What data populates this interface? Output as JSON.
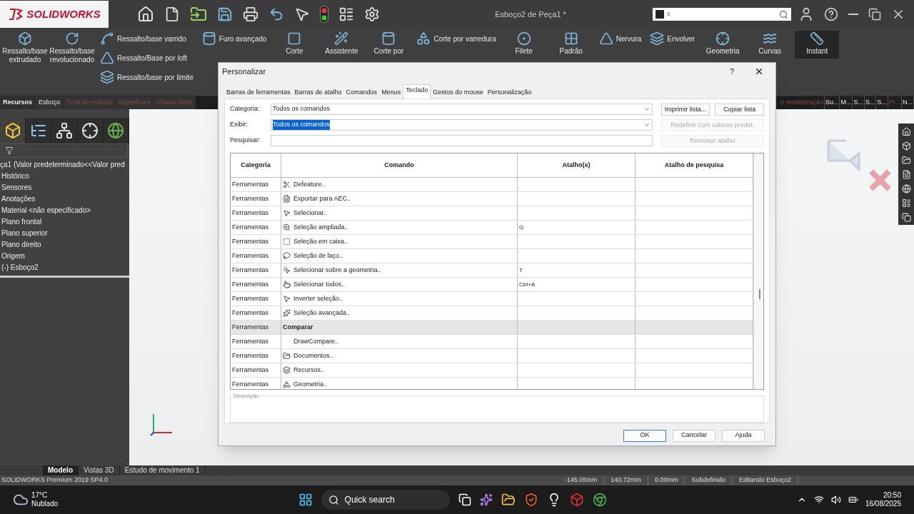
{
  "app": {
    "logo": "SOLIDWORKS",
    "document_title": "Esboço2 de Peça1 *",
    "search": {
      "value": "s"
    }
  },
  "ribbon": [
    {
      "kind": "large",
      "label": "Ressalto/base extrudado"
    },
    {
      "kind": "large",
      "label": "Ressalto/base revolucionado"
    },
    {
      "kind": "stack",
      "items": [
        "Ressalto/base varrido",
        "Ressalto/Base por loft",
        "Ressalto/base por limite"
      ]
    },
    {
      "kind": "stack",
      "items": [
        "Furo avançado"
      ]
    },
    {
      "kind": "large",
      "label": "Corte"
    },
    {
      "kind": "large",
      "label": "Assistente"
    },
    {
      "kind": "large",
      "label": "Corte por"
    },
    {
      "kind": "stack",
      "items": [
        "Corte por varredura"
      ]
    },
    {
      "kind": "large",
      "label": "Filete"
    },
    {
      "kind": "large",
      "label": "Padrão"
    },
    {
      "kind": "stack",
      "items": [
        "Nervura"
      ]
    },
    {
      "kind": "stack",
      "items": [
        "Envolver"
      ]
    },
    {
      "kind": "large",
      "label": "Geometria"
    },
    {
      "kind": "large",
      "label": "Curvas"
    },
    {
      "kind": "large",
      "label": "Instant"
    }
  ],
  "command_tabs": [
    {
      "label": "Recursos",
      "selected": true,
      "disabled": false
    },
    {
      "label": "Esboço",
      "selected": false,
      "disabled": false
    },
    {
      "label": "Tinta de esboço",
      "selected": false,
      "disabled": true
    },
    {
      "label": "Superfícies",
      "selected": false,
      "disabled": true
    },
    {
      "label": "Chapa meta",
      "selected": false,
      "disabled": true
    }
  ],
  "command_tabs_right": [
    {
      "label": "e renderização",
      "selected": false,
      "disabled": true
    },
    {
      "label": "Su...",
      "selected": false,
      "disabled": false
    },
    {
      "label": "M...",
      "selected": false,
      "disabled": false
    },
    {
      "label": "S...",
      "selected": false,
      "disabled": false
    },
    {
      "label": "S...",
      "selected": false,
      "disabled": false
    },
    {
      "label": "S...",
      "selected": false,
      "disabled": false
    },
    {
      "label": "Pr...",
      "selected": false,
      "disabled": true
    },
    {
      "label": "N...",
      "selected": false,
      "disabled": false
    }
  ],
  "feature_tree": {
    "panel_tabs": [
      {
        "selected": true
      },
      {
        "selected": false
      },
      {
        "selected": false
      },
      {
        "selected": false
      },
      {
        "selected": false
      }
    ],
    "root": "ça1  (Valor predeterminado<<Valor pred",
    "items": [
      "Histórico",
      "Sensores",
      "Anotações",
      "Material <não especificado>",
      "Plano frontal",
      "Plano superior",
      "Plano direito",
      "Origem",
      "(-) Esboço2"
    ]
  },
  "bottom_tabs": [
    {
      "label": "Modelo",
      "selected": true
    },
    {
      "label": "Vistas 3D",
      "selected": false
    },
    {
      "label": "Estudo de movimento 1",
      "selected": false
    }
  ],
  "status_bar": {
    "product": "SOLIDWORKS Premium 2019 SP4.0",
    "readouts": [
      "-145.05mm",
      "140.72mm",
      "0.00mm",
      "Subdefinido",
      "Editando Esboço2"
    ]
  },
  "dialog": {
    "title": "Personalizar",
    "help": "?",
    "tabs": [
      {
        "label": "Barras de ferramentas",
        "selected": false
      },
      {
        "label": "Barras de atalho",
        "selected": false
      },
      {
        "label": "Comandos",
        "selected": false
      },
      {
        "label": "Menus",
        "selected": false
      },
      {
        "label": "Teclado",
        "selected": true
      },
      {
        "label": "Gestos do mouse",
        "selected": false
      },
      {
        "label": "Personalização",
        "selected": false
      }
    ],
    "fields": [
      {
        "kind": "dropdown",
        "label": "Categoria:",
        "value": "Todos os comandos",
        "highlighted": false
      },
      {
        "kind": "dropdown",
        "label": "Exibir:",
        "value": "Todos os comandos",
        "highlighted": true
      },
      {
        "kind": "text",
        "label": "Pesquisar:"
      }
    ],
    "side_buttons": [
      {
        "label": "Imprimir lista...",
        "disabled": false
      },
      {
        "label": "Copiar lista",
        "disabled": false
      },
      {
        "label": "Redefinir com valores predet.",
        "disabled": true
      },
      {
        "label": "Remover atalho",
        "disabled": true
      }
    ],
    "table": {
      "columns": [
        "Categoria",
        "Comando",
        "Atalho(s)",
        "Atalho de pesquisa"
      ],
      "rows": [
        {
          "kind": "command",
          "category": "Ferramentas",
          "command": "Defeature.."
        },
        {
          "kind": "command",
          "category": "Ferramentas",
          "command": "Exportar para AEC.."
        },
        {
          "kind": "command",
          "category": "Ferramentas",
          "command": "Selecionar.."
        },
        {
          "kind": "command",
          "category": "Ferramentas",
          "command": "Seleção ampliada..",
          "shortcut": "G"
        },
        {
          "kind": "command",
          "category": "Ferramentas",
          "command": "Seleção em caixa.."
        },
        {
          "kind": "command",
          "category": "Ferramentas",
          "command": "Seleção de laço.."
        },
        {
          "kind": "command",
          "category": "Ferramentas",
          "command": "Selecionar sobre a geometria..",
          "shortcut": "T"
        },
        {
          "kind": "command",
          "category": "Ferramentas",
          "command": "Selecionar todos..",
          "shortcut": "Ctrl+A"
        },
        {
          "kind": "command",
          "category": "Ferramentas",
          "command": "Inverter seleção.."
        },
        {
          "kind": "command",
          "category": "Ferramentas",
          "command": "Seleção avançada.."
        },
        {
          "kind": "group",
          "category": "Ferramentas",
          "command": "Comparar"
        },
        {
          "kind": "command",
          "category": "Ferramentas",
          "command": "DrawCompare.."
        },
        {
          "kind": "command",
          "category": "Ferramentas",
          "command": "Documentos.."
        },
        {
          "kind": "command",
          "category": "Ferramentas",
          "command": "Recursos.."
        },
        {
          "kind": "command",
          "category": "Ferramentas",
          "command": "Geometria.."
        }
      ]
    },
    "description_label": "Descrição",
    "buttons": [
      "OK",
      "Cancelar",
      "Ajuda"
    ]
  },
  "taskbar": {
    "temperature": "17°C",
    "condition": "Nublado",
    "search": "Quick search",
    "time": "20:50",
    "date": "16/08/2025"
  }
}
